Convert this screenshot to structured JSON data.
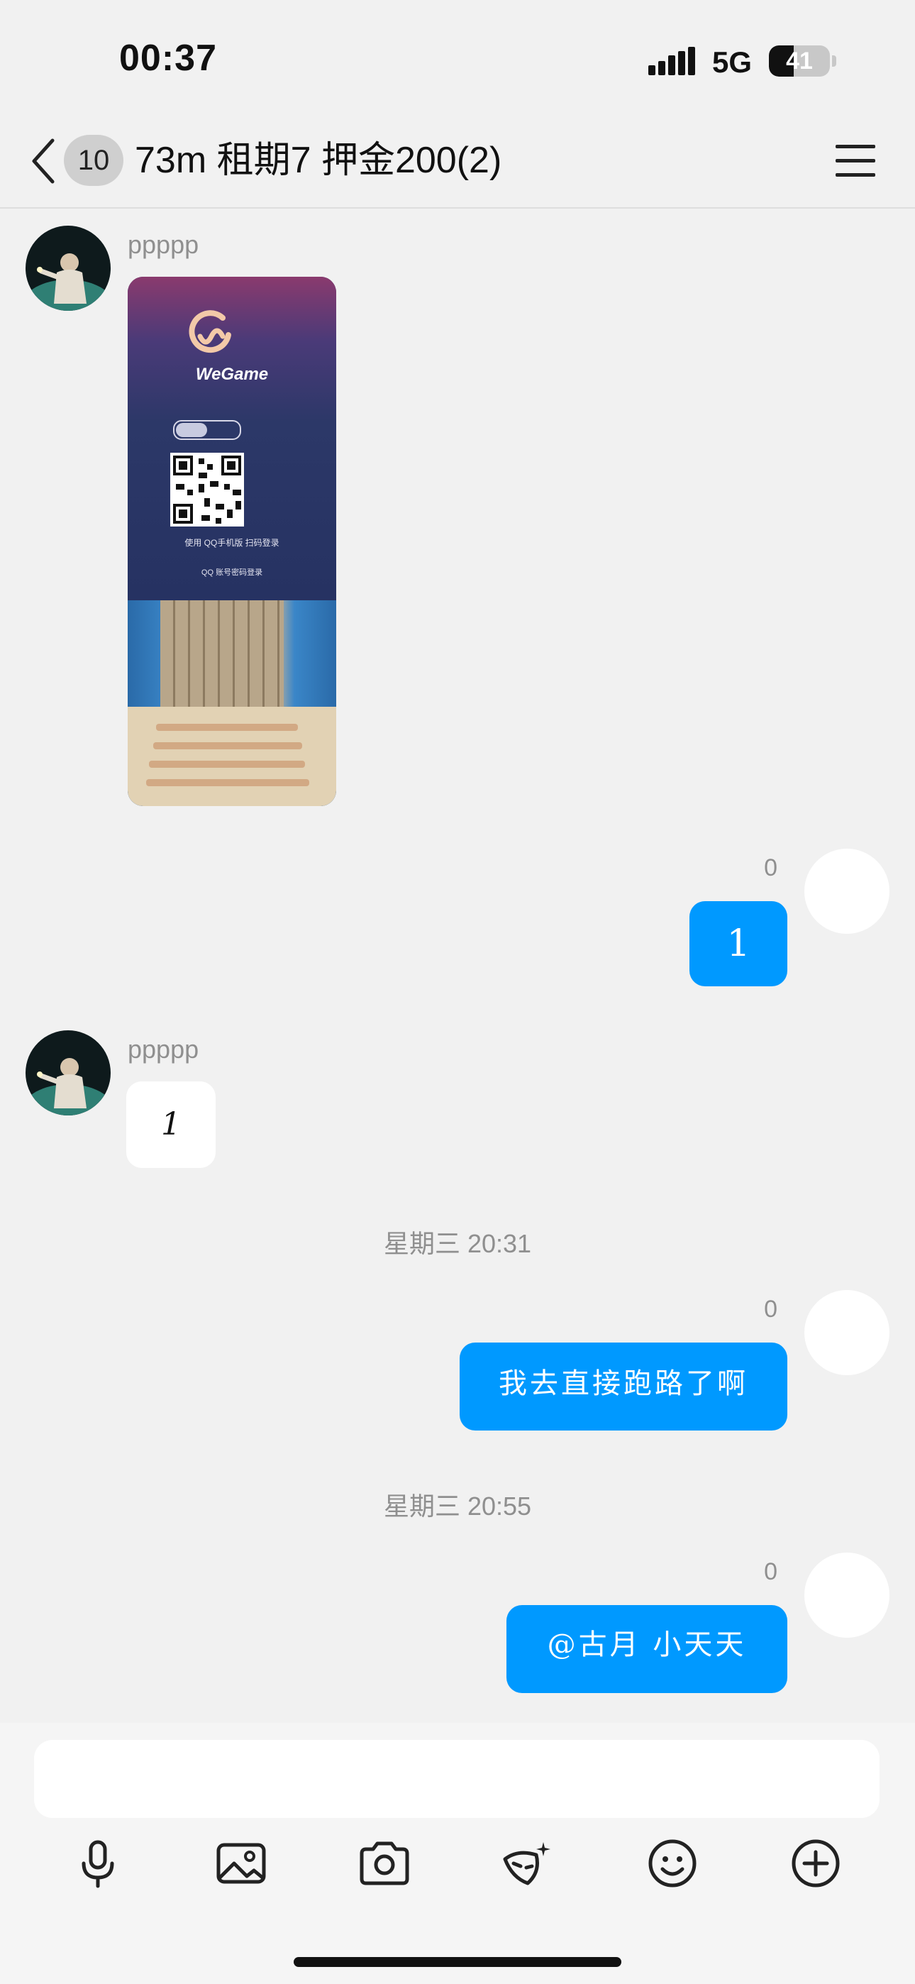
{
  "status_bar": {
    "time": "00:37",
    "network": "5G",
    "battery": "41",
    "battery_level": 0.41
  },
  "header": {
    "unread_count": "10",
    "title": "73m 租期7 押金200(2)"
  },
  "messages": [
    {
      "type": "image",
      "sender": "ppppp",
      "image": {
        "brand": "WeGame",
        "qr_caption": "使用 QQ手机版 扫码登录",
        "alt_login": "QQ 账号密码登录"
      }
    },
    {
      "type": "text",
      "self": true,
      "read_count": "0",
      "text": "1"
    },
    {
      "type": "text",
      "sender": "ppppp",
      "text": "1"
    },
    {
      "type": "timestamp",
      "text": "星期三 20:31"
    },
    {
      "type": "text",
      "self": true,
      "read_count": "0",
      "text": "我去直接跑路了啊"
    },
    {
      "type": "timestamp",
      "text": "星期三 20:55"
    },
    {
      "type": "text",
      "self": true,
      "read_count": "0",
      "text": "@古月 小天天"
    }
  ],
  "toolbar": {
    "icons": [
      "microphone-icon",
      "image-icon",
      "camera-icon",
      "mask-effect-icon",
      "emoji-icon",
      "plus-icon"
    ]
  },
  "colors": {
    "accent": "#0099ff",
    "background": "#f1f1f1"
  }
}
